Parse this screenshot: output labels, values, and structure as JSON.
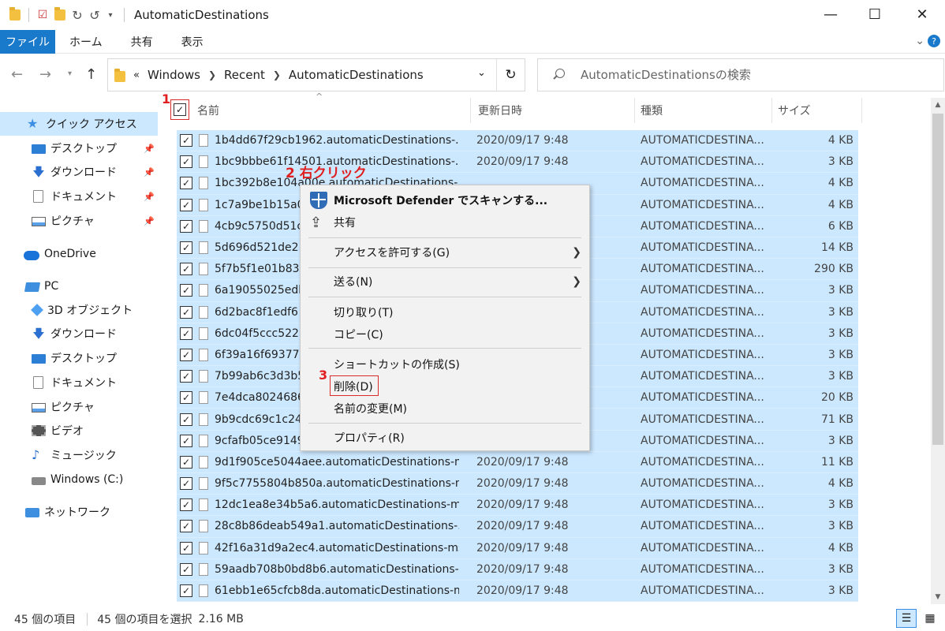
{
  "window": {
    "title": "AutomaticDestinations",
    "minimize_icon": "minimize-icon",
    "maximize_icon": "maximize-icon",
    "close_icon": "close-icon"
  },
  "ribbon": {
    "tabs": [
      {
        "label": "ファイル",
        "active": true
      },
      {
        "label": "ホーム"
      },
      {
        "label": "共有"
      },
      {
        "label": "表示"
      }
    ],
    "help_label": "?"
  },
  "address": {
    "prefix": "«",
    "crumbs": [
      "Windows",
      "Recent",
      "AutomaticDestinations"
    ],
    "search_placeholder": "AutomaticDestinationsの検索"
  },
  "sidebar": {
    "items": [
      {
        "label": "クイック アクセス",
        "icon": "star-icon",
        "active": true
      },
      {
        "label": "デスクトップ",
        "icon": "desktop-icon",
        "pinned": true
      },
      {
        "label": "ダウンロード",
        "icon": "download-icon",
        "pinned": true
      },
      {
        "label": "ドキュメント",
        "icon": "document-icon",
        "pinned": true
      },
      {
        "label": "ピクチャ",
        "icon": "pictures-icon",
        "pinned": true
      },
      {
        "label": "OneDrive",
        "icon": "cloud-icon"
      },
      {
        "label": "PC",
        "icon": "pc-icon"
      },
      {
        "label": "3D オブジェクト",
        "icon": "3d-objects-icon"
      },
      {
        "label": "ダウンロード",
        "icon": "download-icon"
      },
      {
        "label": "デスクトップ",
        "icon": "desktop-icon"
      },
      {
        "label": "ドキュメント",
        "icon": "document-icon"
      },
      {
        "label": "ピクチャ",
        "icon": "pictures-icon"
      },
      {
        "label": "ビデオ",
        "icon": "video-icon"
      },
      {
        "label": "ミュージック",
        "icon": "music-icon"
      },
      {
        "label": "Windows (C:)",
        "icon": "drive-icon"
      },
      {
        "label": "ネットワーク",
        "icon": "network-icon"
      }
    ]
  },
  "columns": {
    "name": "名前",
    "date": "更新日時",
    "type": "種類",
    "size": "サイズ"
  },
  "annotations": {
    "step1": "1",
    "step2": "2 右クリック",
    "step3": "3"
  },
  "files": [
    {
      "name": "1b4dd67f29cb1962.automaticDestinations-...",
      "date": "2020/09/17 9:48",
      "type": "AUTOMATICDESTINA...",
      "size": "4 KB"
    },
    {
      "name": "1bc9bbbe61f14501.automaticDestinations-...",
      "date": "2020/09/17 9:48",
      "type": "AUTOMATICDESTINA...",
      "size": "3 KB"
    },
    {
      "name": "1bc392b8e104a00e.automaticDestinations-...",
      "date": "",
      "type": "AUTOMATICDESTINA...",
      "size": "4 KB"
    },
    {
      "name": "1c7a9be1b15a0",
      "date": "",
      "type": "AUTOMATICDESTINA...",
      "size": "4 KB"
    },
    {
      "name": "4cb9c5750d51c",
      "date": "",
      "type": "AUTOMATICDESTINA...",
      "size": "6 KB"
    },
    {
      "name": "5d696d521de2",
      "date": "",
      "type": "AUTOMATICDESTINA...",
      "size": "14 KB"
    },
    {
      "name": "5f7b5f1e01b83",
      "date": "",
      "type": "AUTOMATICDESTINA...",
      "size": "290 KB"
    },
    {
      "name": "6a19055025edb",
      "date": "",
      "type": "AUTOMATICDESTINA...",
      "size": "3 KB"
    },
    {
      "name": "6d2bac8f1edf6",
      "date": "",
      "type": "AUTOMATICDESTINA...",
      "size": "3 KB"
    },
    {
      "name": "6dc04f5ccc5228",
      "date": "",
      "type": "AUTOMATICDESTINA...",
      "size": "3 KB"
    },
    {
      "name": "6f39a16f693777",
      "date": "",
      "type": "AUTOMATICDESTINA...",
      "size": "3 KB"
    },
    {
      "name": "7b99ab6c3d3b5",
      "date": "",
      "type": "AUTOMATICDESTINA...",
      "size": "3 KB"
    },
    {
      "name": "7e4dca80246863",
      "date": "",
      "type": "AUTOMATICDESTINA...",
      "size": "20 KB"
    },
    {
      "name": "9b9cdc69c1c24",
      "date": "",
      "type": "AUTOMATICDESTINA...",
      "size": "71 KB"
    },
    {
      "name": "9cfafb05ce9149",
      "date": "",
      "type": "AUTOMATICDESTINA...",
      "size": "3 KB"
    },
    {
      "name": "9d1f905ce5044aee.automaticDestinations-ms",
      "date": "2020/09/17 9:48",
      "type": "AUTOMATICDESTINA...",
      "size": "11 KB"
    },
    {
      "name": "9f5c7755804b850a.automaticDestinations-ms",
      "date": "2020/09/17 9:48",
      "type": "AUTOMATICDESTINA...",
      "size": "4 KB"
    },
    {
      "name": "12dc1ea8e34b5a6.automaticDestinations-ms",
      "date": "2020/09/17 9:48",
      "type": "AUTOMATICDESTINA...",
      "size": "3 KB"
    },
    {
      "name": "28c8b86deab549a1.automaticDestinations-...",
      "date": "2020/09/17 9:48",
      "type": "AUTOMATICDESTINA...",
      "size": "3 KB"
    },
    {
      "name": "42f16a31d9a2ec4.automaticDestinations-ms",
      "date": "2020/09/17 9:48",
      "type": "AUTOMATICDESTINA...",
      "size": "4 KB"
    },
    {
      "name": "59aadb708b0bd8b6.automaticDestinations-...",
      "date": "2020/09/17 9:48",
      "type": "AUTOMATICDESTINA...",
      "size": "3 KB"
    },
    {
      "name": "61ebb1e65cfcb8da.automaticDestinations-ms",
      "date": "2020/09/17 9:48",
      "type": "AUTOMATICDESTINA...",
      "size": "3 KB"
    }
  ],
  "context_menu": {
    "scan": "Microsoft Defender でスキャンする...",
    "share": "共有",
    "grant_access": "アクセスを許可する(G)",
    "send_to": "送る(N)",
    "cut": "切り取り(T)",
    "copy": "コピー(C)",
    "create_shortcut": "ショートカットの作成(S)",
    "delete": "削除(D)",
    "rename": "名前の変更(M)",
    "properties": "プロパティ(R)"
  },
  "status": {
    "count": "45 個の項目",
    "selected": "45 個の項目を選択",
    "size": "2.16 MB"
  },
  "colors": {
    "accent": "#1979ca",
    "selection": "#cce8ff",
    "annotation": "#e02020"
  }
}
